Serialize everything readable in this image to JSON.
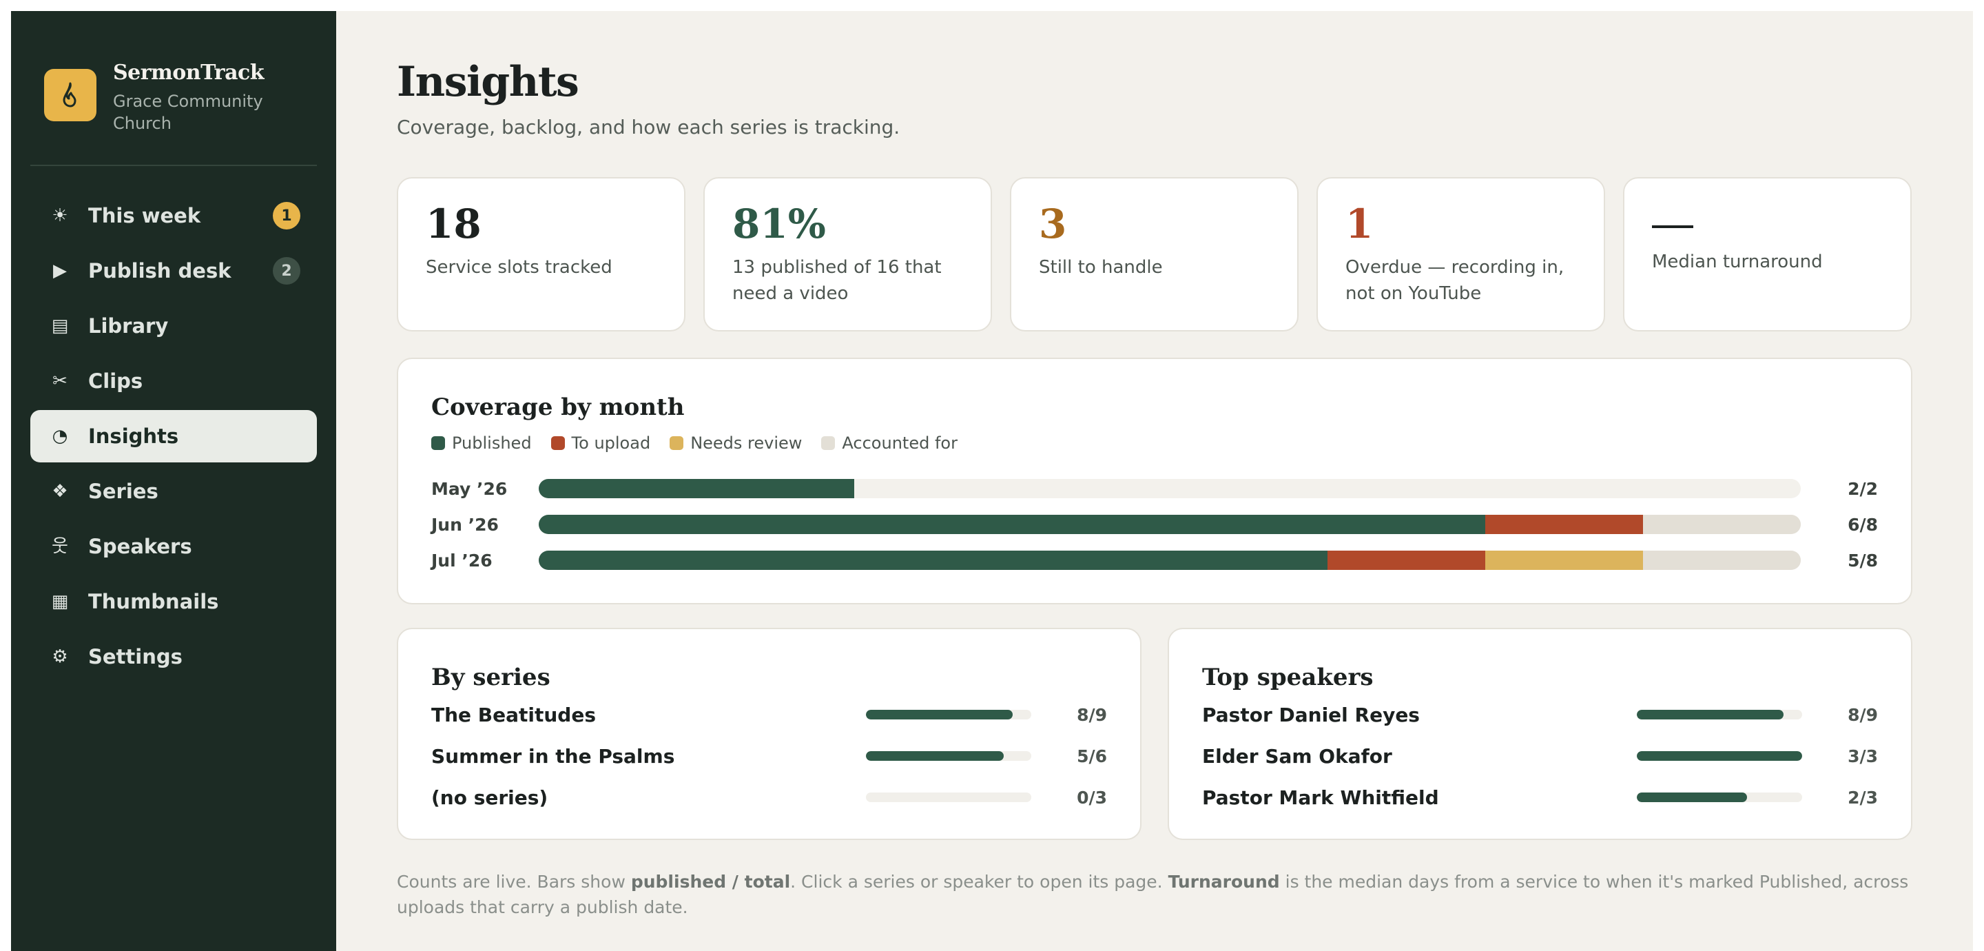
{
  "brand": {
    "name": "SermonTrack",
    "subtitle": "Grace Community Church",
    "logo_icon": "flame-icon",
    "logo_color": "#e8b54a"
  },
  "nav": [
    {
      "label": "This week",
      "icon": "sun-icon",
      "glyph": "☀",
      "badge": "1",
      "badge_style": "warn",
      "active": false
    },
    {
      "label": "Publish desk",
      "icon": "play-icon",
      "glyph": "▶",
      "badge": "2",
      "badge_style": "muted",
      "active": false
    },
    {
      "label": "Library",
      "icon": "library-icon",
      "glyph": "▤",
      "badge": null,
      "active": false
    },
    {
      "label": "Clips",
      "icon": "scissors-icon",
      "glyph": "✂",
      "badge": null,
      "active": false
    },
    {
      "label": "Insights",
      "icon": "pie-chart-icon",
      "glyph": "◔",
      "badge": null,
      "active": true
    },
    {
      "label": "Series",
      "icon": "diamond-grid-icon",
      "glyph": "❖",
      "badge": null,
      "active": false
    },
    {
      "label": "Speakers",
      "icon": "person-icon",
      "glyph": "웃",
      "badge": null,
      "active": false
    },
    {
      "label": "Thumbnails",
      "icon": "grid-icon",
      "glyph": "▦",
      "badge": null,
      "active": false
    },
    {
      "label": "Settings",
      "icon": "gear-icon",
      "glyph": "⚙",
      "badge": null,
      "active": false
    }
  ],
  "page": {
    "title": "Insights",
    "subtitle": "Coverage, backlog, and how each series is tracking."
  },
  "stats": [
    {
      "value": "18",
      "label": "Service slots tracked",
      "color": "#1c2120"
    },
    {
      "value": "81%",
      "label": "13 published of 16 that need a video",
      "color": "#2f5a48"
    },
    {
      "value": "3",
      "label": "Still to handle",
      "color": "#a86a1e"
    },
    {
      "value": "1",
      "label": "Overdue — recording in, not on YouTube",
      "color": "#b1492a"
    },
    {
      "value": "—",
      "label": "Median turnaround",
      "color": "#1c2120",
      "dash": true
    }
  ],
  "coverage": {
    "title": "Coverage by month",
    "legend": [
      {
        "label": "Published",
        "key": "published",
        "color": "#2f5a48"
      },
      {
        "label": "To upload",
        "key": "to_upload",
        "color": "#b1492a"
      },
      {
        "label": "Needs review",
        "key": "needs_review",
        "color": "#dcb45c"
      },
      {
        "label": "Accounted for",
        "key": "accounted_for",
        "color": "#e3dfd6"
      }
    ]
  },
  "chart_data": {
    "type": "bar",
    "orientation": "horizontal",
    "stacked": true,
    "categories": [
      "May ’26",
      "Jun ’26",
      "Jul ’26"
    ],
    "series": [
      {
        "name": "Published",
        "values": [
          2,
          6,
          5
        ]
      },
      {
        "name": "To upload",
        "values": [
          0,
          1,
          1
        ]
      },
      {
        "name": "Needs review",
        "values": [
          0,
          0,
          1
        ]
      },
      {
        "name": "Accounted for",
        "values": [
          0,
          1,
          1
        ]
      }
    ],
    "scale_max": 8,
    "totals_labels": [
      "2/2",
      "6/8",
      "5/8"
    ],
    "legend": "top-left"
  },
  "by_series": {
    "title": "By series",
    "rows": [
      {
        "name": "The Beatitudes",
        "published": 8,
        "total": 9,
        "count": "8/9"
      },
      {
        "name": "Summer in the Psalms",
        "published": 5,
        "total": 6,
        "count": "5/6"
      },
      {
        "name": "(no series)",
        "published": 0,
        "total": 3,
        "count": "0/3"
      }
    ]
  },
  "top_speakers": {
    "title": "Top speakers",
    "rows": [
      {
        "name": "Pastor Daniel Reyes",
        "published": 8,
        "total": 9,
        "count": "8/9"
      },
      {
        "name": "Elder Sam Okafor",
        "published": 3,
        "total": 3,
        "count": "3/3"
      },
      {
        "name": "Pastor Mark Whitfield",
        "published": 2,
        "total": 3,
        "count": "2/3"
      }
    ]
  },
  "footnote": {
    "t1": "Counts are live. Bars show ",
    "b1": "published / total",
    "t2": ". Click a series or speaker to open its page. ",
    "b2": "Turnaround",
    "t3": " is the median days from a service to when it's marked Published, across uploads that carry a publish date."
  }
}
